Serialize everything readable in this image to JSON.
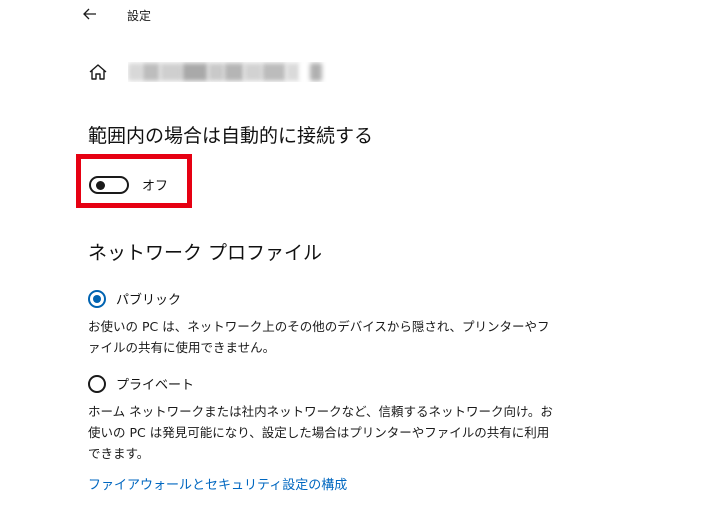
{
  "window": {
    "title": "設定"
  },
  "auto_connect": {
    "heading": "範囲内の場合は自動的に接続する",
    "toggle_state": "off",
    "toggle_label": "オフ"
  },
  "network_profile": {
    "heading": "ネットワーク プロファイル",
    "options": [
      {
        "label": "パブリック",
        "selected": true,
        "description": "お使いの PC は、ネットワーク上のその他のデバイスから隠され、プリンターやファイルの共有に使用できません。"
      },
      {
        "label": "プライベート",
        "selected": false,
        "description": "ホーム ネットワークまたは社内ネットワークなど、信頼するネットワーク向け。お使いの PC は発見可能になり、設定した場合はプリンターやファイルの共有に利用できます。"
      }
    ]
  },
  "firewall_link": "ファイアウォールとセキュリティ設定の構成",
  "colors": {
    "accent": "#0063b1",
    "link": "#0067c0",
    "highlight": "#e60012"
  },
  "icons": {
    "back": "back-arrow-icon",
    "home": "home-icon"
  }
}
